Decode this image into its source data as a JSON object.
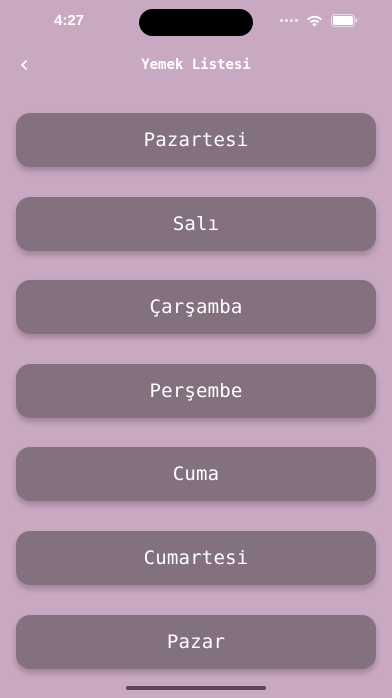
{
  "status_bar": {
    "time": "4:27",
    "icons": [
      "signal-icon",
      "wifi-icon",
      "battery-icon"
    ]
  },
  "nav": {
    "back_label": "<",
    "title": "Yemek Listesi"
  },
  "days": [
    {
      "label": "Pazartesi"
    },
    {
      "label": "Salı"
    },
    {
      "label": "Çarşamba"
    },
    {
      "label": "Perşembe"
    },
    {
      "label": "Cuma"
    },
    {
      "label": "Cumartesi"
    },
    {
      "label": "Pazar"
    }
  ],
  "colors": {
    "background": "#c9a8c2",
    "button": "#83717f",
    "text": "#ffffff"
  }
}
